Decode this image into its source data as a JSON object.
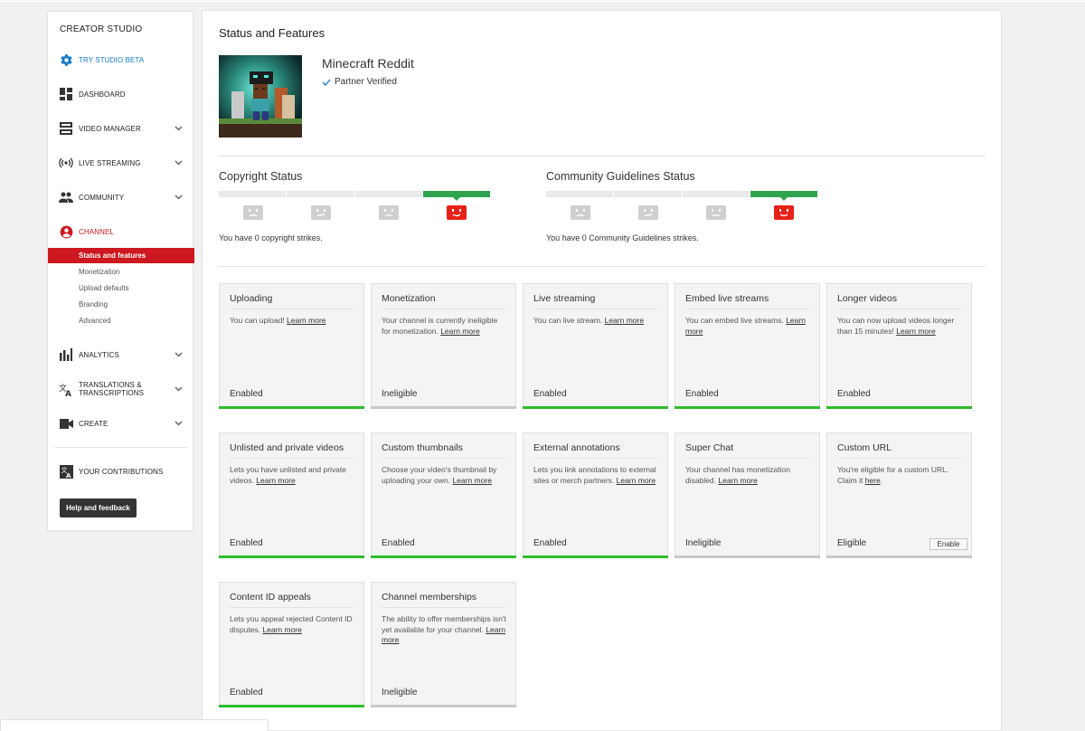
{
  "sidebar": {
    "title": "CREATOR STUDIO",
    "try_beta": "TRY STUDIO BETA",
    "dashboard": "DASHBOARD",
    "video_manager": "VIDEO MANAGER",
    "live_streaming": "LIVE STREAMING",
    "community": "COMMUNITY",
    "channel": "CHANNEL",
    "channel_sub": [
      "Status and features",
      "Monetization",
      "Upload defaults",
      "Branding",
      "Advanced"
    ],
    "analytics": "ANALYTICS",
    "translations_1": "TRANSLATIONS &",
    "translations_2": "TRANSCRIPTIONS",
    "create": "CREATE",
    "contributions": "YOUR CONTRIBUTIONS",
    "help": "Help and feedback"
  },
  "page": {
    "title": "Status and Features",
    "channel_name": "Minecraft Reddit",
    "partner": "Partner Verified"
  },
  "copyright": {
    "title": "Copyright Status",
    "text": "You have 0 copyright strikes."
  },
  "community": {
    "title": "Community Guidelines Status",
    "text": "You have 0 Community Guidelines strikes."
  },
  "colors": {
    "accent_red": "#cc181e",
    "accent_blue": "#167ac6",
    "enabled_green": "#2dbd2d",
    "strike_green": "#2ea44f"
  },
  "cards": [
    {
      "title": "Uploading",
      "desc": "You can upload! ",
      "link": "Learn more",
      "status": "Enabled",
      "green": true
    },
    {
      "title": "Monetization",
      "desc": "Your channel is currently ineligible for monetization. ",
      "link": "Learn more",
      "status": "Ineligible",
      "green": false
    },
    {
      "title": "Live streaming",
      "desc": "You can live stream. ",
      "link": "Learn more",
      "status": "Enabled",
      "green": true
    },
    {
      "title": "Embed live streams",
      "desc": "You can embed live streams. ",
      "link": "Learn more",
      "status": "Enabled",
      "green": true
    },
    {
      "title": "Longer videos",
      "desc": "You can now upload videos longer than 15 minutes! ",
      "link": "Learn more",
      "status": "Enabled",
      "green": true
    },
    {
      "title": "Unlisted and private videos",
      "desc": "Lets you have unlisted and private videos. ",
      "link": "Learn more",
      "status": "Enabled",
      "green": true
    },
    {
      "title": "Custom thumbnails",
      "desc": "Choose your video's thumbnail by uploading your own. ",
      "link": "Learn more",
      "status": "Enabled",
      "green": true
    },
    {
      "title": "External annotations",
      "desc": "Lets you link annotations to external sites or merch partners. ",
      "link": "Learn more",
      "status": "Enabled",
      "green": true
    },
    {
      "title": "Super Chat",
      "desc": "Your channel has monetization disabled. ",
      "link": "Learn more",
      "status": "Ineligible",
      "green": false
    },
    {
      "title": "Custom URL",
      "desc": "You're eligible for a custom URL. Claim it ",
      "link": "here",
      "suffix": ".",
      "status": "Eligible",
      "green": false,
      "button": "Enable"
    },
    {
      "title": "Content ID appeals",
      "desc": "Lets you appeal rejected Content ID disputes. ",
      "link": "Learn more",
      "status": "Enabled",
      "green": true
    },
    {
      "title": "Channel memberships",
      "desc": "The ability to offer memberships isn't yet available for your channel. ",
      "link": "Learn more",
      "status": "Ineligible",
      "green": false
    }
  ]
}
